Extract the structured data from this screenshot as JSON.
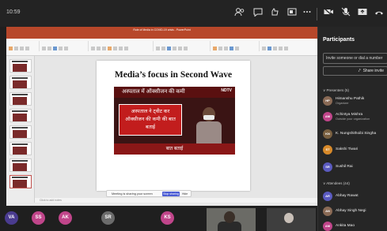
{
  "topbar": {
    "time": "10:59",
    "icons": [
      "participants-icon",
      "chat-icon",
      "reactions-icon",
      "view-icon",
      "more-icon",
      "camera-off-icon",
      "mic-off-icon",
      "share-screen-icon",
      "leave-icon"
    ]
  },
  "shared_screen": {
    "ppt_title": "Role of Media in COVID-19 crisis - PowerPoint",
    "ppt_menu": [
      "File",
      "Home",
      "Insert",
      "Transitions",
      "Animations",
      "Slide Show",
      "Review",
      "View",
      "Recording",
      "Help",
      "Design Ideas"
    ],
    "slide_title": "Media’s focus in Second Wave",
    "news_top": "अस्पताल में ऑक्सीजन की कमी",
    "news_logo": "NDTV",
    "news_box": "अस्पताल ने ट्वीट कर ऑक्सीजन की कमी की बात बताई",
    "news_bottom": "बात बताई",
    "notes_placeholder": "Click to add notes",
    "share_notice": {
      "text": "Meeting is sharing your screen",
      "stop_label": "Stop sharing",
      "hide_label": "Hide"
    }
  },
  "gallery": [
    {
      "initials": "VA",
      "color": "#4a3b8f"
    },
    {
      "initials": "SS",
      "color": "#c0458a"
    },
    {
      "initials": "AK",
      "color": "#c0458a"
    },
    {
      "initials": "SR",
      "color": "#6b6b6b"
    },
    {
      "initials": "KS",
      "color": "#c0458a"
    }
  ],
  "panel": {
    "title": "Participants",
    "invite_placeholder": "Invite someone or dial a number",
    "share_invite_label": "Share invite",
    "presenters_label": "Presenters (5)",
    "presenters": [
      {
        "name": "Himanshu Pathik",
        "role": "Organizer",
        "initials": "HP",
        "color": "#8a6a55"
      },
      {
        "name": "Achintya Mishra",
        "role": "Outside your organization",
        "initials": "AM",
        "color": "#c0458a"
      },
      {
        "name": "K. Nungshithoibi Singha",
        "role": "",
        "initials": "KN",
        "color": "#7a6040"
      },
      {
        "name": "Sakshi Tiwari",
        "role": "",
        "initials": "ST",
        "color": "#d88a2a"
      },
      {
        "name": "Sushil Rai",
        "role": "",
        "initials": "SR",
        "color": "#5a5ac0"
      }
    ],
    "attendees_label": "Attendees (44)",
    "attendees": [
      {
        "name": "Abhay Rawat",
        "role": "",
        "initials": "AR",
        "color": "#5a5ac0"
      },
      {
        "name": "Abhay Singh Negi",
        "role": "",
        "initials": "AN",
        "color": "#8a6a55"
      },
      {
        "name": "Ankita Mao",
        "role": "",
        "initials": "AM",
        "color": "#c0458a"
      }
    ]
  }
}
